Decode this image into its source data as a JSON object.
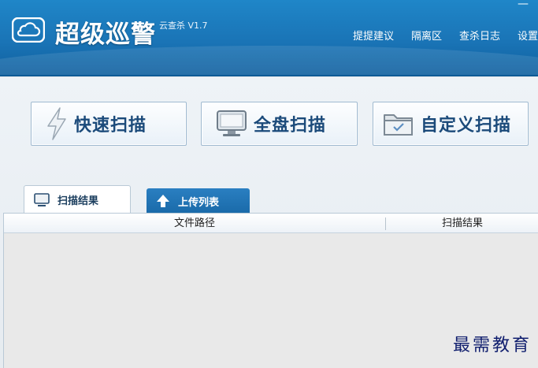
{
  "app": {
    "name": "超级巡警",
    "subtitle": "云查杀 V1.7"
  },
  "nav": [
    "提提建议",
    "隔离区",
    "查杀日志",
    "设置"
  ],
  "window_controls": {
    "minimize": "—"
  },
  "scan_buttons": [
    {
      "label": "快速扫描",
      "icon": "lightning-icon"
    },
    {
      "label": "全盘扫描",
      "icon": "monitor-icon"
    },
    {
      "label": "自定义扫描",
      "icon": "folder-check-icon"
    }
  ],
  "tabs": [
    {
      "label": "扫描结果",
      "icon": "monitor-icon",
      "active": true
    },
    {
      "label": "上传列表",
      "icon": "upload-arrow-icon",
      "active": false
    }
  ],
  "table": {
    "columns": [
      "文件路径",
      "扫描结果"
    ],
    "rows": []
  },
  "watermark": "最需教育",
  "colors": {
    "header": "#1a74b6",
    "accent_text": "#1b4a7a",
    "tab_inactive": "#1a6aa9"
  }
}
